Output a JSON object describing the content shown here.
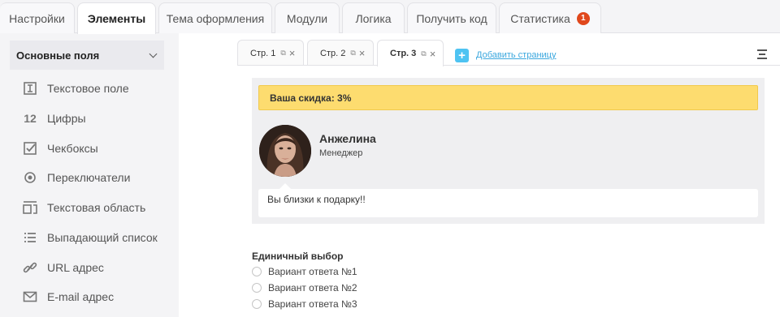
{
  "top_tabs": {
    "settings": "Настройки",
    "elements": "Элементы",
    "theme": "Тема оформления",
    "modules": "Модули",
    "logic": "Логика",
    "get_code": "Получить код",
    "statistics": "Статистика",
    "statistics_badge": "1"
  },
  "sidebar": {
    "header": "Основные поля",
    "items": [
      {
        "label": "Текстовое поле",
        "icon": "text-field-icon"
      },
      {
        "label": "Цифры",
        "icon": "numbers-icon",
        "glyph": "12"
      },
      {
        "label": "Чекбоксы",
        "icon": "checkbox-icon"
      },
      {
        "label": "Переключатели",
        "icon": "radio-icon"
      },
      {
        "label": "Текстовая область",
        "icon": "textarea-icon"
      },
      {
        "label": "Выпадающий список",
        "icon": "list-icon"
      },
      {
        "label": "URL адрес",
        "icon": "link-icon"
      },
      {
        "label": "E-mail адрес",
        "icon": "email-icon"
      }
    ]
  },
  "page_tabs": [
    {
      "label": "Стр. 1"
    },
    {
      "label": "Стр. 2"
    },
    {
      "label": "Стр. 3",
      "active": true
    }
  ],
  "add_page": "Добавить страницу",
  "content": {
    "discount": "Ваша скидка: 3%",
    "person_name": "Анжелина",
    "person_role": "Менеджер",
    "message": "Вы близки к подарку!!"
  },
  "single_choice": {
    "title": "Единичный выбор",
    "options": [
      "Вариант ответа №1",
      "Вариант ответа №2",
      "Вариант ответа №3"
    ]
  },
  "colors": {
    "discount_bg": "#fddc6f",
    "badge": "#e0481c",
    "accent": "#4ec3f2"
  }
}
